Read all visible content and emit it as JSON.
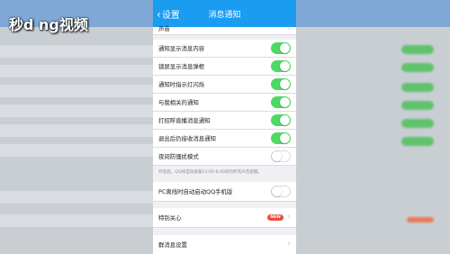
{
  "watermark": "秒d ng视频",
  "nav": {
    "back_label": "设置",
    "title": "消息通知"
  },
  "partial_top_label": "声音",
  "settings": [
    {
      "label": "通知显示消息内容",
      "on": true
    },
    {
      "label": "锁屏显示消息弹框",
      "on": true
    },
    {
      "label": "通知时指示灯闪烁",
      "on": true
    },
    {
      "label": "与我相关的通知",
      "on": true
    },
    {
      "label": "打招呼直播消息通知",
      "on": true
    },
    {
      "label": "退出后仍接收消息通知",
      "on": true
    },
    {
      "label": "夜间防骚扰模式",
      "on": false
    }
  ],
  "night_mode_note": "开启后，QQ将自动屏蔽23:00-8:00间的所有声音提醒。",
  "pc_offline_label": "PC离线时自动启动QQ手机版",
  "pc_offline_on": false,
  "special_care_label": "特别关心",
  "special_care_badge": "NEW",
  "group_settings_label": "群消息设置",
  "colors": {
    "nav": "#1a9cf0",
    "toggle_on": "#4cd964",
    "badge": "#f04a3a"
  }
}
